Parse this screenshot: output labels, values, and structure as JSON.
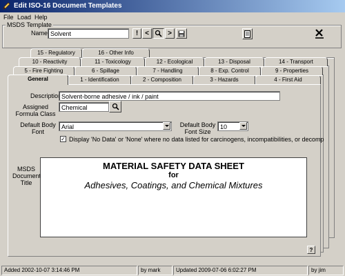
{
  "window": {
    "title": "Edit ISO-16 Document Templates",
    "icon": "pencil-icon"
  },
  "menu": [
    "File",
    "Load",
    "Help"
  ],
  "template_group": {
    "label": "MSDS Template",
    "name_label": "Name",
    "name_value": "Solvent",
    "buttons": {
      "exclaim": "!",
      "prev": "<",
      "search_icon": "search-icon",
      "next": ">",
      "save_icon": "floppy-disk-icon",
      "doc_icon": "document-icon",
      "delete_icon": "delete-x-icon"
    }
  },
  "tabs": {
    "row1": [
      "15 - Regulatory",
      "16 - Other Info"
    ],
    "row2": [
      "10 - Reactivity",
      "11 - Toxicology",
      "12 - Ecological",
      "13 - Disposal",
      "14 - Transport"
    ],
    "row3": [
      "5 - Fire Fighting",
      "6 - Spillage",
      "7 - Handling",
      "8 - Exp. Control",
      "9 - Properties"
    ],
    "row4": [
      "General",
      "1 - Identification",
      "2 - Composition",
      "3 - Hazards",
      "4 - First Aid"
    ]
  },
  "general": {
    "description_label": "Description",
    "description_value": "Solvent-borne adhesive / ink / paint",
    "formula_label": "Assigned Formula Class",
    "formula_value": "Chemical",
    "font_label": "Default Body Font",
    "font_value": "Arial",
    "font_size_label": "Default Body Font Size",
    "font_size_value": "10",
    "no_data_checked": true,
    "no_data_label": "Display 'No Data' or 'None' where no data listed for carcinogens, incompatibilities, or decomp",
    "doc_title_label": "MSDS Document Title",
    "doc_title_line1": "MATERIAL SAFETY DATA SHEET",
    "doc_title_line2": "for",
    "doc_title_line3": "Adhesives, Coatings, and Chemical Mixtures",
    "help_button": "?"
  },
  "status": {
    "added": "Added 2002-10-07 3:14:46 PM",
    "added_by": "by mark",
    "updated": "Updated 2009-07-06 6:02:27 PM",
    "updated_by": "by jim"
  }
}
